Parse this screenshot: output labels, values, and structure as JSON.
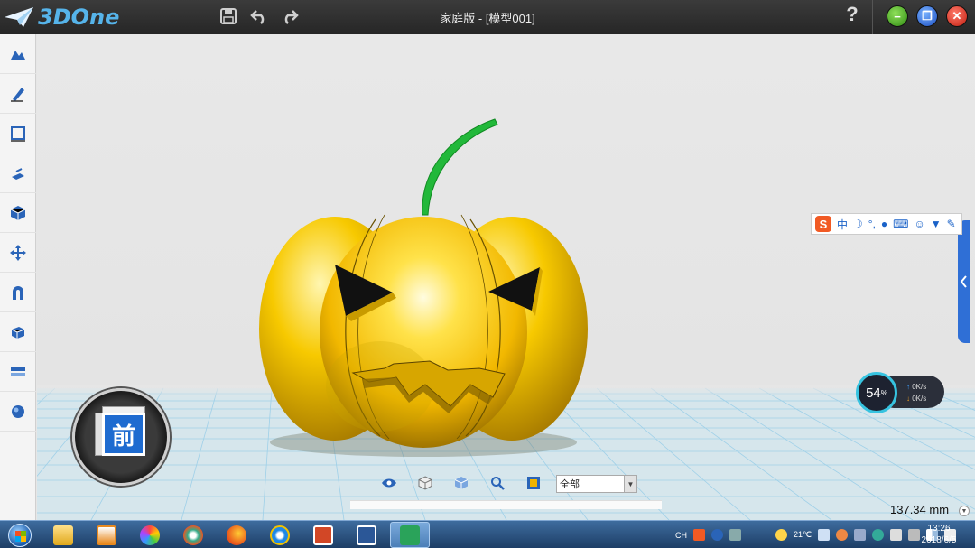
{
  "app": {
    "logo_text": "3DOne",
    "window_title": "家庭版 - [模型001]",
    "help_label": "?",
    "colors": {
      "accent": "#2f6fd6",
      "logo": "#56b4ea",
      "pumpkin": "#f5c400",
      "stem": "#22b83a"
    }
  },
  "titlebar": {
    "icons": [
      "save-icon",
      "undo-icon",
      "redo-icon"
    ],
    "window_buttons": [
      "minimize-button",
      "restore-button",
      "close-button"
    ]
  },
  "left_toolbar": {
    "tools": [
      "basic-solid-tool",
      "sketch-tool",
      "sketch-edit-tool",
      "feature-tool",
      "special-function-tool",
      "move-tool",
      "combine-tool",
      "distance-measure-tool",
      "view-tool",
      "material-render-tool"
    ]
  },
  "ime": {
    "logo": "S",
    "mode": "中"
  },
  "net_speed": {
    "percent": "54",
    "percent_unit": "%",
    "up": "0K/s",
    "down": "0K/s"
  },
  "view_cube": {
    "face_label": "前"
  },
  "view_toolbar": {
    "icons": [
      "eye-icon",
      "cube-wireframe-icon",
      "cube-shaded-icon",
      "zoom-icon",
      "fit-view-icon"
    ],
    "filter_value": "全部"
  },
  "measure": {
    "value": "137.34 mm"
  },
  "taskbar": {
    "apps": [
      "file-explorer",
      "media-player",
      "photos",
      "browser-alt",
      "firefox",
      "internet-explorer",
      "powerpoint",
      "word",
      "3done"
    ],
    "active_app": "3done",
    "tray_lang": "CH",
    "temperature": "21℃",
    "time": "13:26",
    "date": "2018/6/5"
  }
}
